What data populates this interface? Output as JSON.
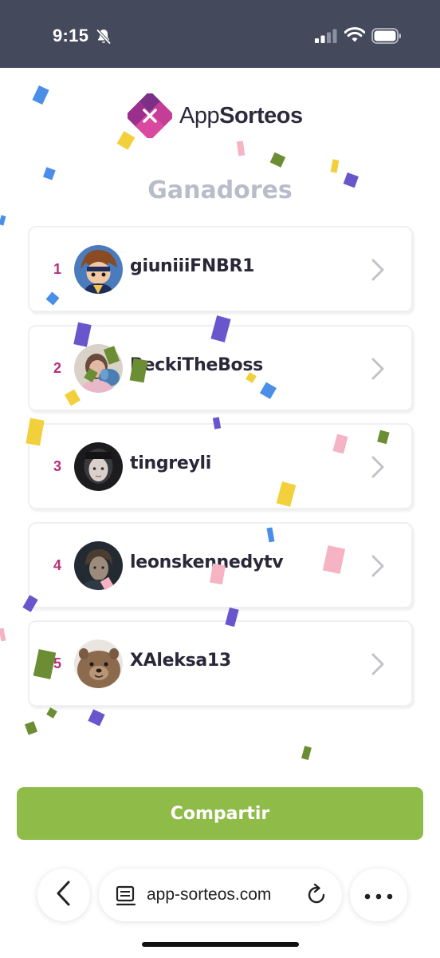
{
  "status_bar": {
    "time": "9:15",
    "icons": [
      "bell-slash-icon",
      "cellular-signal-icon",
      "wifi-icon",
      "battery-icon"
    ]
  },
  "brand": {
    "name_light": "App",
    "name_bold": "Sorteos",
    "colors": {
      "mark_dark": "#7c2f86",
      "mark_light": "#c43d97",
      "text": "#2d2a3e"
    }
  },
  "page": {
    "title": "Ganadores"
  },
  "winners": [
    {
      "rank": "1",
      "username": "giuniiiFNBR1",
      "avatar_icon": "anime-avatar"
    },
    {
      "rank": "2",
      "username": "BeckiTheBoss",
      "avatar_icon": "photo-avatar"
    },
    {
      "rank": "3",
      "username": "tingreyli",
      "avatar_icon": "photo-avatar"
    },
    {
      "rank": "4",
      "username": "leonskennedytv",
      "avatar_icon": "photo-avatar"
    },
    {
      "rank": "5",
      "username": "XAleksa13",
      "avatar_icon": "quokka-avatar"
    }
  ],
  "actions": {
    "share_label": "Compartir"
  },
  "browser": {
    "url": "app-sorteos.com",
    "icons": [
      "back-chevron-icon",
      "tabs-icon",
      "reload-icon",
      "more-dots-icon"
    ]
  },
  "colors": {
    "status_bar_bg": "#444a5c",
    "rank_color": "#b5307b",
    "title_color": "#b9bcc9",
    "share_button_bg": "#8fbc48",
    "confetti": [
      "#4a8ee8",
      "#f2d03b",
      "#6a56cc",
      "#f5b3c3",
      "#6b8e34"
    ]
  }
}
